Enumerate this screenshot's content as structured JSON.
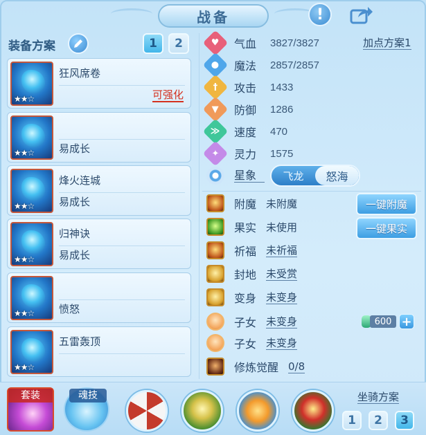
{
  "title": "战备",
  "left": {
    "plan_label": "装备方案",
    "plan_buttons": [
      "1",
      "2"
    ],
    "equipment": [
      {
        "name": "狂风席卷",
        "status": "",
        "action": "可强化",
        "stars": "★★☆"
      },
      {
        "name": "",
        "status": "易成长",
        "action": "",
        "stars": "★★☆"
      },
      {
        "name": "烽火连城",
        "status": "易成长",
        "action": "",
        "stars": "★★☆"
      },
      {
        "name": "归神诀",
        "status": "易成长",
        "action": "",
        "stars": "★★☆"
      },
      {
        "name": "",
        "status": "愤怒",
        "action": "",
        "stars": "★★☆"
      },
      {
        "name": "五雷轰顶",
        "status": "",
        "action": "",
        "stars": "★★☆"
      }
    ]
  },
  "stats": {
    "add_point_plan": "加点方案1",
    "items": [
      {
        "label": "气血",
        "value": "3827/3827",
        "icon": "heart-icon",
        "color": "#e8607a"
      },
      {
        "label": "魔法",
        "value": "2857/2857",
        "icon": "mana-icon",
        "color": "#4fa6ea"
      },
      {
        "label": "攻击",
        "value": "1433",
        "icon": "attack-icon",
        "color": "#f0b640"
      },
      {
        "label": "防御",
        "value": "1286",
        "icon": "defense-icon",
        "color": "#f09a5a"
      },
      {
        "label": "速度",
        "value": "470",
        "icon": "speed-icon",
        "color": "#3fc79a"
      },
      {
        "label": "灵力",
        "value": "1575",
        "icon": "spirit-icon",
        "color": "#c48ae8"
      }
    ],
    "star_sign": {
      "label": "星象",
      "options": [
        "飞龙",
        "怒海"
      ],
      "selected": "怒海"
    }
  },
  "features": {
    "items": [
      {
        "label": "附魔",
        "value": "未附魔",
        "underline": false
      },
      {
        "label": "果实",
        "value": "未使用",
        "underline": false
      },
      {
        "label": "祈福",
        "value": "未祈福",
        "underline": true
      },
      {
        "label": "封地",
        "value": "未受赏",
        "underline": true
      },
      {
        "label": "变身",
        "value": "未变身",
        "underline": true
      },
      {
        "label": "子女",
        "value": "未变身",
        "underline": true
      },
      {
        "label": "子女",
        "value": "未变身",
        "underline": true
      },
      {
        "label": "修炼觉醒",
        "value": "0/8",
        "underline": true
      }
    ],
    "one_key_enchant": "一键附魔",
    "one_key_fruit": "一键果实",
    "jade_value": "600"
  },
  "bottom": {
    "suit_label": "套装",
    "soul_label": "魂技",
    "mount_label": "坐骑方案",
    "mount_buttons": [
      "1",
      "2",
      "3"
    ]
  }
}
